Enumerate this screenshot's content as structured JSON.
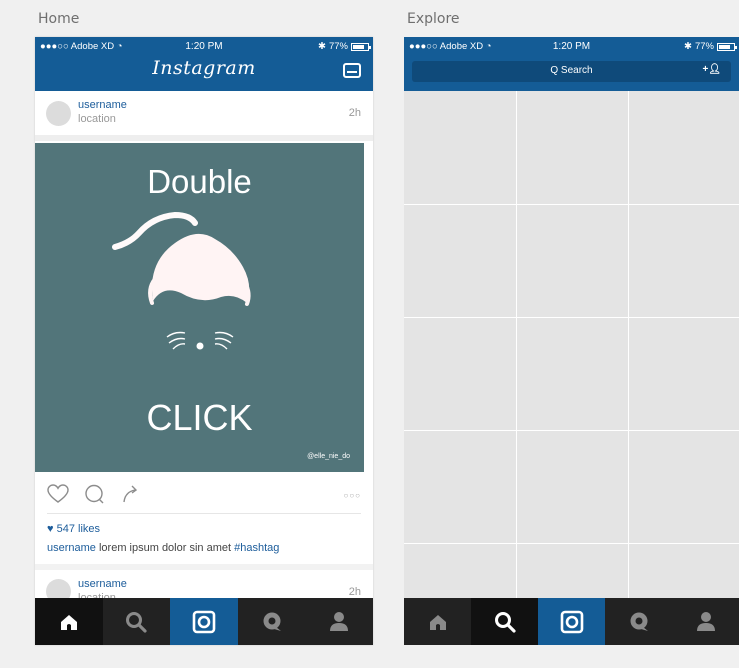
{
  "artboards": {
    "home_label": "Home",
    "explore_label": "Explore"
  },
  "status_bar": {
    "carrier": "●●●○○ Adobe XD",
    "time": "1:20 PM",
    "battery": "77%"
  },
  "home": {
    "brand": "Instagram",
    "post": {
      "username": "username",
      "location": "location",
      "time_ago": "2h",
      "image_text_top": "Double",
      "image_text_bottom": "CLICK",
      "image_credit": "@elle_nie_do",
      "likes": "♥ 547 likes",
      "caption_user": "username",
      "caption_text": "lorem ipsum dolor sin amet",
      "caption_tag": "#hashtag"
    },
    "post2": {
      "username": "username",
      "location": "location",
      "time_ago": "2h"
    }
  },
  "explore": {
    "search_placeholder": "Q Search",
    "add_user_icon": "+person-icon"
  },
  "colors": {
    "brand_blue": "#145c96",
    "tabbar": "#222222",
    "post_image_bg": "#52757a",
    "link_blue": "#1d5d9b"
  },
  "tabbar": {
    "items": [
      "home-icon",
      "search-icon",
      "camera-icon",
      "activity-icon",
      "profile-icon"
    ]
  }
}
